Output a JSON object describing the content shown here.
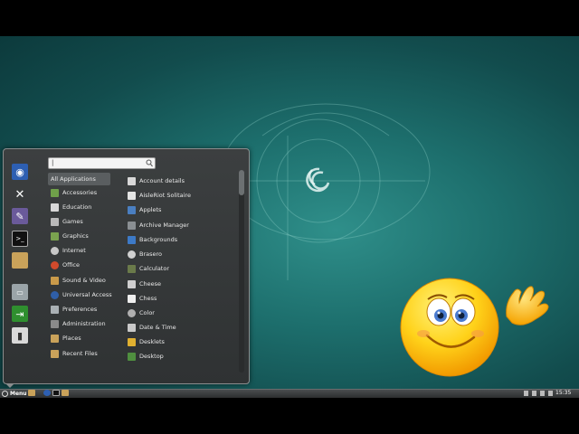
{
  "colors": {
    "desktop_teal": "#1d6f6d",
    "menu_bg": "#3c3f40",
    "active_category": "#5a5e60",
    "text": "#e8e8e8"
  },
  "favorites": [
    {
      "icon": "firefox-icon"
    },
    {
      "icon": "tools-icon"
    },
    {
      "icon": "pidgin-icon"
    },
    {
      "icon": "terminal-icon"
    },
    {
      "icon": "folder-icon"
    },
    {
      "icon": "display-icon"
    },
    {
      "icon": "logout-icon"
    },
    {
      "icon": "shutdown-icon"
    }
  ],
  "search": {
    "value": "|"
  },
  "categories": [
    {
      "label": "All Applications",
      "icon": "all-apps-icon"
    },
    {
      "label": "Accessories",
      "icon": "accessories-icon"
    },
    {
      "label": "Education",
      "icon": "education-icon"
    },
    {
      "label": "Games",
      "icon": "games-icon"
    },
    {
      "label": "Graphics",
      "icon": "graphics-icon"
    },
    {
      "label": "Internet",
      "icon": "internet-icon"
    },
    {
      "label": "Office",
      "icon": "office-icon"
    },
    {
      "label": "Sound & Video",
      "icon": "sound-video-icon"
    },
    {
      "label": "Universal Access",
      "icon": "universal-access-icon"
    },
    {
      "label": "Preferences",
      "icon": "preferences-icon"
    },
    {
      "label": "Administration",
      "icon": "administration-icon"
    },
    {
      "label": "Places",
      "icon": "places-icon"
    },
    {
      "label": "Recent Files",
      "icon": "recent-files-icon"
    }
  ],
  "applications": [
    {
      "label": "Account details",
      "icon": "account-icon"
    },
    {
      "label": "AisleRiot Solitaire",
      "icon": "solitaire-icon"
    },
    {
      "label": "Applets",
      "icon": "applets-icon"
    },
    {
      "label": "Archive Manager",
      "icon": "archive-icon"
    },
    {
      "label": "Backgrounds",
      "icon": "backgrounds-icon"
    },
    {
      "label": "Brasero",
      "icon": "brasero-icon"
    },
    {
      "label": "Calculator",
      "icon": "calculator-icon"
    },
    {
      "label": "Cheese",
      "icon": "cheese-icon"
    },
    {
      "label": "Chess",
      "icon": "chess-icon"
    },
    {
      "label": "Color",
      "icon": "color-icon"
    },
    {
      "label": "Date & Time",
      "icon": "date-time-icon"
    },
    {
      "label": "Desklets",
      "icon": "desklets-icon"
    },
    {
      "label": "Desktop",
      "icon": "desktop-icon"
    }
  ],
  "taskbar": {
    "menu_label": "Menu",
    "clock": "15:35"
  }
}
